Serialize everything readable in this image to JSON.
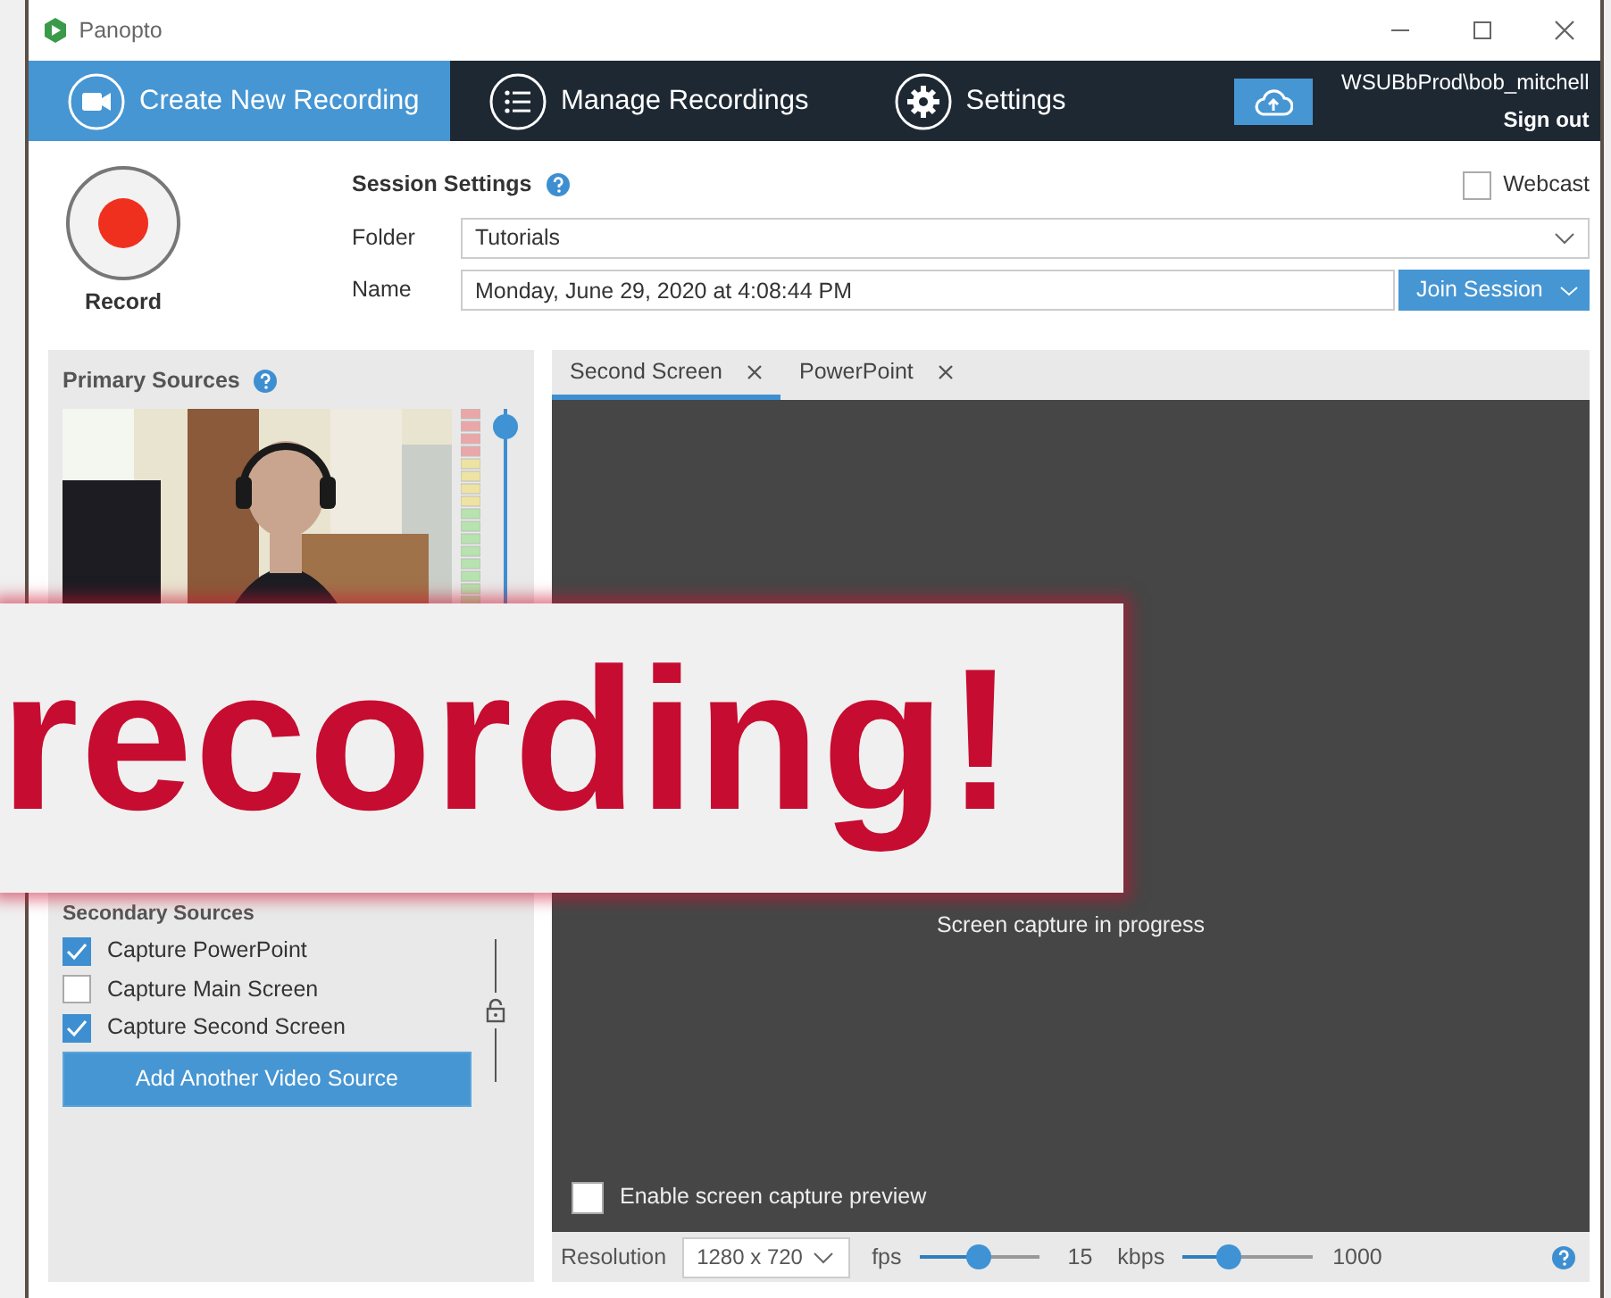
{
  "window": {
    "title": "Panopto"
  },
  "nav": {
    "tabs": [
      {
        "label": "Create New Recording",
        "selected": true
      },
      {
        "label": "Manage Recordings",
        "selected": false
      },
      {
        "label": "Settings",
        "selected": false
      }
    ],
    "user": "WSUBbProd\\bob_mitchell",
    "sign_out": "Sign out"
  },
  "record": {
    "label": "Record"
  },
  "session": {
    "heading": "Session Settings",
    "webcast": {
      "label": "Webcast",
      "checked": false
    },
    "folder": {
      "label": "Folder",
      "value": "Tutorials"
    },
    "name": {
      "label": "Name",
      "value": "Monday, June 29, 2020 at 4:08:44 PM"
    },
    "join_button": "Join Session"
  },
  "primary_sources": {
    "heading": "Primary Sources",
    "volume": {
      "level": 0.97
    }
  },
  "secondary_sources": {
    "heading": "Secondary Sources",
    "items": [
      {
        "label": "Capture PowerPoint",
        "checked": true
      },
      {
        "label": "Capture Main Screen",
        "checked": false
      },
      {
        "label": "Capture Second Screen",
        "checked": true
      }
    ],
    "add_button": "Add Another Video Source"
  },
  "preview": {
    "tabs": [
      {
        "label": "Second Screen",
        "selected": true
      },
      {
        "label": "PowerPoint",
        "selected": false
      }
    ],
    "message": "Screen capture in progress",
    "enable_preview": {
      "label": "Enable screen capture preview",
      "checked": false
    }
  },
  "settings_bar": {
    "resolution_label": "Resolution",
    "resolution": "1280 x 720",
    "fps_label": "fps",
    "fps": {
      "level": 0.5
    },
    "fps_value": "15",
    "kbps_label": "kbps",
    "kbps": {
      "level": 0.36
    },
    "kbps_value": "1000"
  },
  "banner": {
    "text": "recording!"
  }
}
